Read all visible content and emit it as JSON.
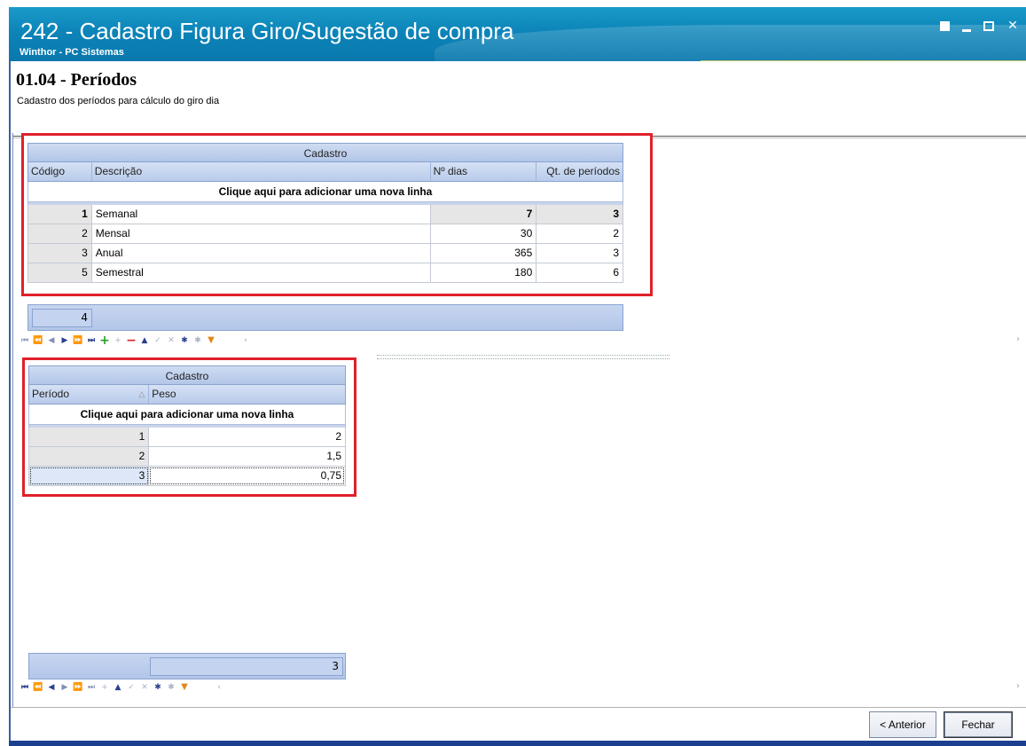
{
  "window": {
    "title": "242 - Cadastro Figura Giro/Sugestão de compra",
    "subtitle": "Winthor - PC Sistemas",
    "close_glyph": "✕"
  },
  "step": {
    "number": "01.04",
    "title": " - Períodos",
    "description": "Cadastro dos períodos para cálculo do giro dia"
  },
  "grid1": {
    "band": "Cadastro",
    "headers": {
      "codigo": "Código",
      "descricao": "Descrição",
      "ndias": "Nº dias",
      "qtperiodos": "Qt. de períodos"
    },
    "add_row_label": "Clique aqui para adicionar uma nova linha",
    "rows": [
      {
        "codigo": "1",
        "descricao": "Semanal",
        "ndias": "7",
        "qtperiodos": "3"
      },
      {
        "codigo": "2",
        "descricao": "Mensal",
        "ndias": "30",
        "qtperiodos": "2"
      },
      {
        "codigo": "3",
        "descricao": "Anual",
        "ndias": "365",
        "qtperiodos": "3"
      },
      {
        "codigo": "5",
        "descricao": "Semestral",
        "ndias": "180",
        "qtperiodos": "6"
      }
    ],
    "footer_count": "4"
  },
  "grid2": {
    "band": "Cadastro",
    "headers": {
      "periodo": "Período",
      "peso": "Peso"
    },
    "sort_glyph": "△",
    "add_row_label": "Clique aqui para adicionar uma nova linha",
    "rows": [
      {
        "periodo": "1",
        "peso": "2"
      },
      {
        "periodo": "2",
        "peso": "1,5"
      },
      {
        "periodo": "3",
        "peso": "0,75"
      }
    ],
    "footer_count": "3"
  },
  "buttons": {
    "anterior": "< Anterior",
    "fechar": "Fechar"
  },
  "colors": {
    "titlebar": "#0c84b8",
    "highlight_box": "#e0202a",
    "grid_header": "#b9cbeb"
  }
}
